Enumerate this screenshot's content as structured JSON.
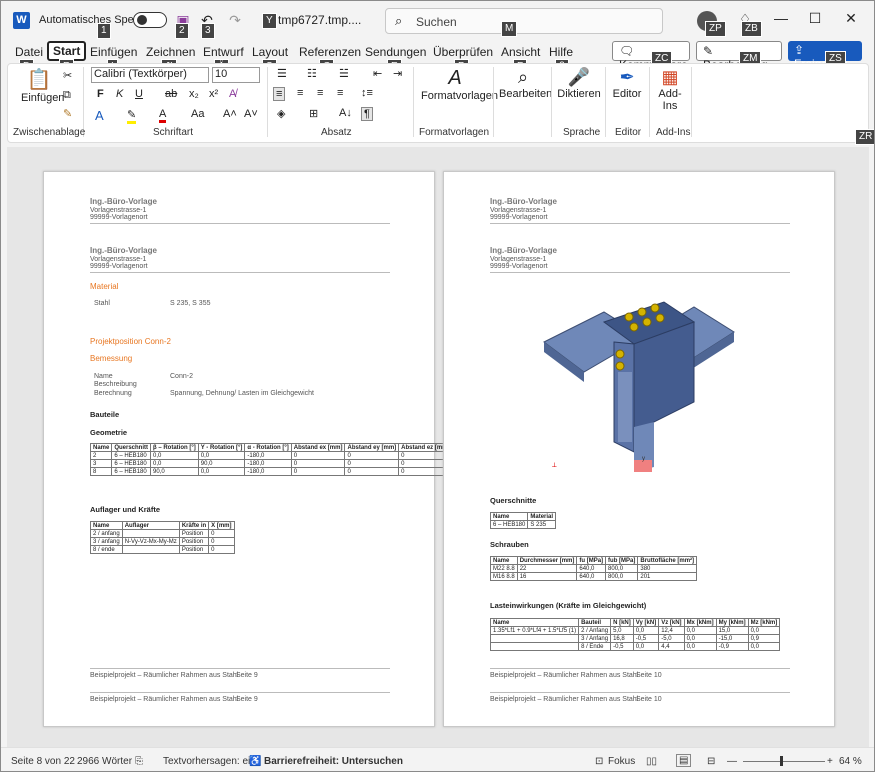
{
  "title": {
    "autosave": "Automatisches Speichern",
    "filename": "tmp6727.tmp....",
    "search": "Suchen",
    "word_logo": "W"
  },
  "keytips": {
    "autosave": "1",
    "save": "2",
    "undo": "3",
    "fname": "Y",
    "search": "M",
    "avatar": "ZP",
    "bulb": "ZB",
    "datei": "D",
    "start": "R",
    "einfuegen": "I",
    "zeichnen": "JI",
    "entwurf": "Ä",
    "layout": "S",
    "referenzen": "C",
    "sendungen": "E",
    "ueberpruefen": "P",
    "ansicht": "F",
    "hilfe": "ß",
    "kommentare": "ZC",
    "bearbeitung": "ZM",
    "freigeben": "ZS",
    "collapse": "ZR"
  },
  "tabs": [
    "Datei",
    "Start",
    "Einfügen",
    "Zeichnen",
    "Entwurf",
    "Layout",
    "Referenzen",
    "Sendungen",
    "Überprüfen",
    "Ansicht",
    "Hilfe"
  ],
  "right_buttons": {
    "kommentare": "Kommentare",
    "bearbeitung": "Bearbeitung",
    "freigeben": "Freigeben"
  },
  "ribbon": {
    "einfuegen": "Einfügen",
    "font": "Calibri (Textkörper)",
    "size": "10",
    "formatvorlagen": "Formatvorlagen",
    "bearbeiten": "Bearbeiten",
    "diktieren": "Diktieren",
    "editor": "Editor",
    "addins": "Add-Ins"
  },
  "groups": {
    "zwischenablage": "Zwischenablage",
    "schriftart": "Schriftart",
    "absatz": "Absatz",
    "formatvorlagen": "Formatvorlagen",
    "sprache": "Sprache",
    "editor": "Editor",
    "addins": "Add-Ins"
  },
  "header": {
    "company": "Ing.-Büro-Vorlage",
    "street": "Vorlagenstrasse-1",
    "city": "99999-Vorlagenort"
  },
  "page1": {
    "material": "Material",
    "stahl_label": "Stahl",
    "stahl_value": "S 235, S 355",
    "projekt": "Projektposition Conn-2",
    "bemessung": "Bemessung",
    "name_label": "Name",
    "name_value": "Conn-2",
    "beschreibung_label": "Beschreibung",
    "berechnung_label": "Berechnung",
    "berechnung_value": "Spannung, Dehnung/ Lasten im Gleichgewicht",
    "bauteile": "Bauteile",
    "geometrie": "Geometrie",
    "geo_headers": [
      "Name",
      "Querschnitt",
      "β – Rotation [°]",
      "Y - Rotation [°]",
      "α - Rotation [°]",
      "Abstand ex [mm]",
      "Abstand ey [mm]",
      "Abstand ez [mm]"
    ],
    "geo_rows": [
      [
        "2",
        "6 – HEB180",
        "0,0",
        "0,0",
        "-180,0",
        "0",
        "0",
        "0"
      ],
      [
        "3",
        "6 – HEB180",
        "0,0",
        "90,0",
        "-180,0",
        "0",
        "0",
        "0"
      ],
      [
        "8",
        "6 – HEB180",
        "90,0",
        "0,0",
        "-180,0",
        "0",
        "0",
        "0"
      ]
    ],
    "auflager": "Auflager und Kräfte",
    "auf_headers": [
      "Name",
      "Auflager",
      "Kräfte in",
      "X [mm]"
    ],
    "auf_rows": [
      [
        "2 / anfang",
        "",
        "Position",
        "0"
      ],
      [
        "3 / anfang",
        "N-Vy-Vz-Mx-My-Mz",
        "Position",
        "0"
      ],
      [
        "8 / ende",
        "",
        "Position",
        "0"
      ]
    ],
    "footer": "Beispielprojekt – Räumlicher Rahmen aus Stahl",
    "footer_page": "Seite 9"
  },
  "page2": {
    "querschnitte": "Querschnitte",
    "qs_headers": [
      "Name",
      "Material"
    ],
    "qs_rows": [
      [
        "6 – HEB180",
        "S 235"
      ]
    ],
    "schrauben": "Schrauben",
    "sc_headers": [
      "Name",
      "Durchmesser [mm]",
      "fu [MPa]",
      "fub [MPa]",
      "Bruttofläche [mm²]"
    ],
    "sc_rows": [
      [
        "M22 8.8",
        "22",
        "640,0",
        "800,0",
        "380"
      ],
      [
        "M16 8.8",
        "16",
        "640,0",
        "800,0",
        "201"
      ]
    ],
    "lasten": "Lasteinwirkungen (Kräfte im Gleichgewicht)",
    "la_headers": [
      "Name",
      "Bauteil",
      "N [kN]",
      "Vy [kN]",
      "Vz [kN]",
      "Mx [kNm]",
      "My [kNm]",
      "Mz [kNm]"
    ],
    "la_rows": [
      [
        "1.35*Lf1 + 0.9*Lf4 + 1.5*Lf5 (1)",
        "2 / Anfang",
        "5,0",
        "0,0",
        "12,4",
        "0,0",
        "15,0",
        "0,0"
      ],
      [
        "",
        "3 / Anfang",
        "16,8",
        "-0,5",
        "-5,0",
        "0,0",
        "-15,0",
        "0,9"
      ],
      [
        "",
        "8 / Ende",
        "-0,5",
        "0,0",
        "4,4",
        "0,0",
        "-0,9",
        "0,0"
      ]
    ],
    "footer": "Beispielprojekt – Räumlicher Rahmen aus Stahl",
    "footer_page": "Seite 10"
  },
  "status": {
    "page": "Seite 8 von 22",
    "words": "2966 Wörter",
    "predictions": "Textvorhersagen: ein",
    "accessibility": "Barrierefreiheit: Untersuchen",
    "focus": "Fokus",
    "zoom": "64 %"
  }
}
